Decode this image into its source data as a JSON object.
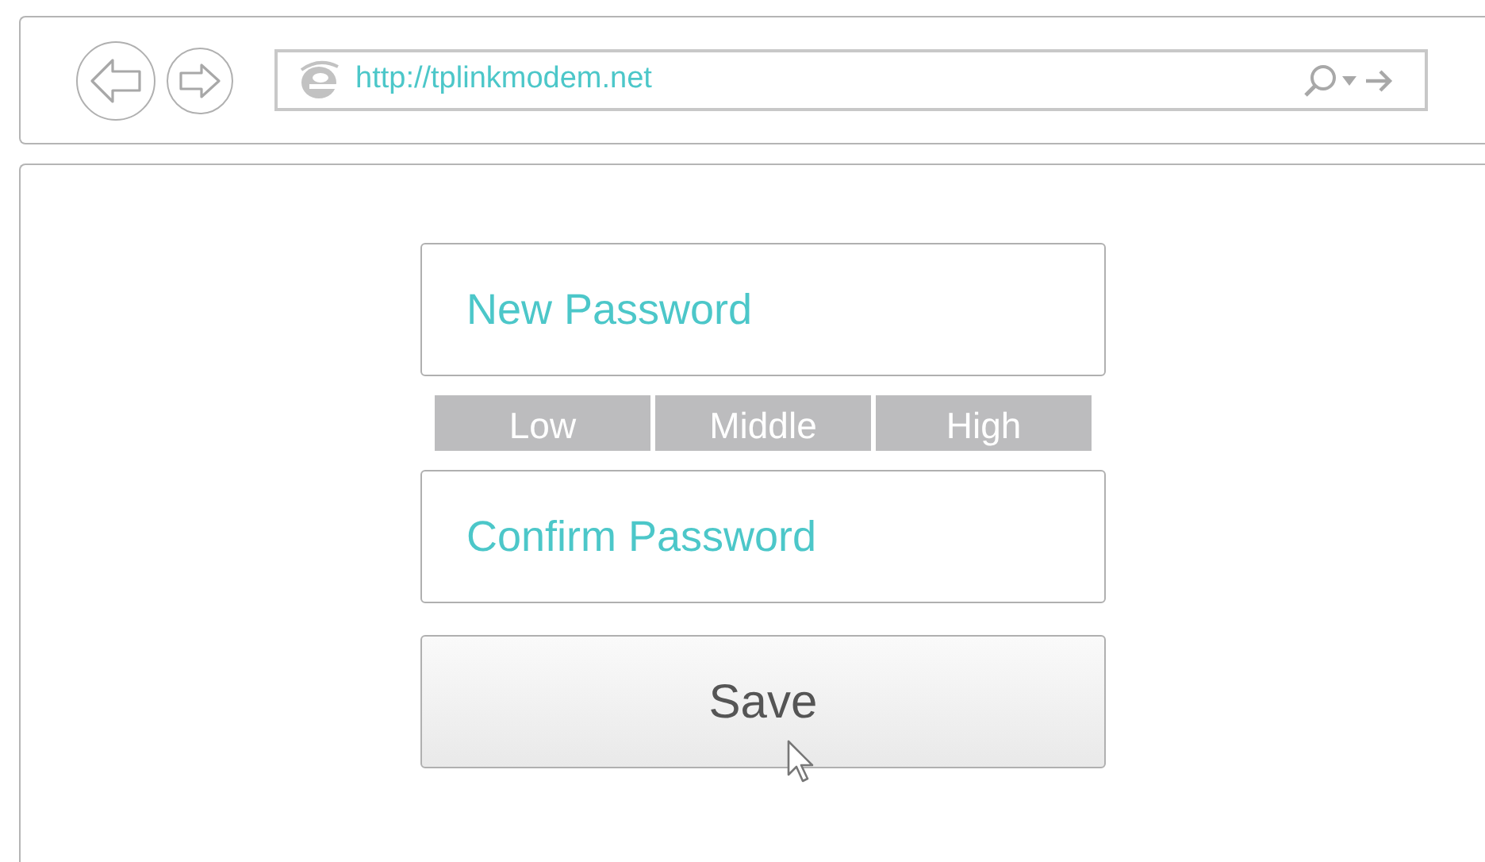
{
  "browser": {
    "address": "http://tplinkmodem.net"
  },
  "form": {
    "new_password": {
      "placeholder": "New Password"
    },
    "strength_levels": [
      "Low",
      "Middle",
      "High"
    ],
    "confirm_password": {
      "placeholder": "Confirm Password"
    },
    "save_button": "Save"
  }
}
